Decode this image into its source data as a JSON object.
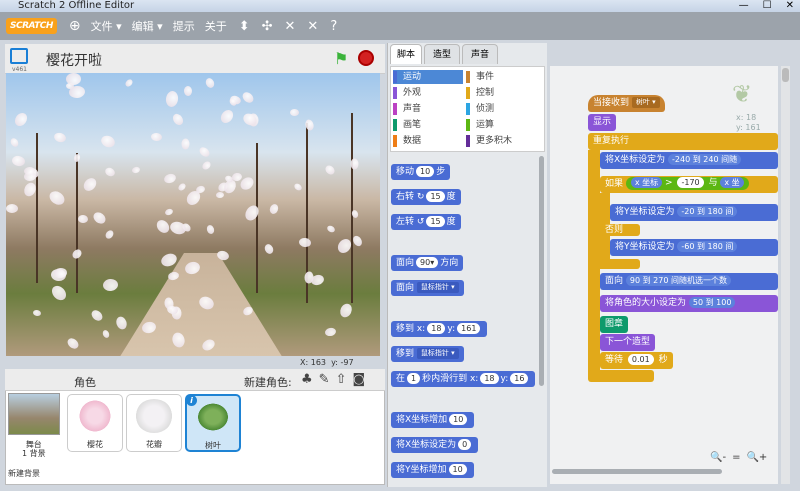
{
  "window": {
    "title": "Scratch 2 Offline Editor",
    "controls": [
      "—",
      "☐",
      "✕"
    ]
  },
  "menubar": {
    "logo": "SCRATCH",
    "menus": [
      "文件 ▾",
      "编辑 ▾",
      "提示",
      "关于"
    ],
    "tools": [
      "⬍",
      "✣",
      "✕",
      "✕",
      "?"
    ]
  },
  "stage": {
    "project_title": "樱花开啦",
    "version": "v461",
    "mouse_x_label": "X:",
    "mouse_x": "163",
    "mouse_y_label": "y:",
    "mouse_y": "-97"
  },
  "sprites": {
    "label": "角色",
    "new_sprite_label": "新建角色:",
    "stage_thumb": {
      "name": "舞台",
      "count": "1 背景"
    },
    "new_bg_label": "新建背景",
    "items": [
      {
        "name": "樱花"
      },
      {
        "name": "花瓣"
      },
      {
        "name": "树叶"
      }
    ]
  },
  "palette": {
    "tabs": [
      "脚本",
      "造型",
      "声音"
    ],
    "categories_left": [
      "运动",
      "外观",
      "声音",
      "画笔",
      "数据"
    ],
    "categories_right": [
      "事件",
      "控制",
      "侦测",
      "运算",
      "更多积木"
    ],
    "colors_left": [
      "#4a6cd4",
      "#8a55d7",
      "#bb42c3",
      "#0e9a6c",
      "#ee7d16"
    ],
    "colors_right": [
      "#c88330",
      "#e1a91a",
      "#2ca5e2",
      "#5cb712",
      "#632d99"
    ],
    "blocks": {
      "move": "移动",
      "move_val": "10",
      "move_unit": "步",
      "turn_right": "右转",
      "turn_right_val": "15",
      "turn_right_unit": "度",
      "turn_left": "左转",
      "turn_left_val": "15",
      "turn_left_unit": "度",
      "point_dir": "面向",
      "point_dir_val": "90▾",
      "point_dir_unit": "方向",
      "point_towards": "面向",
      "point_towards_val": "鼠标指针 ▾",
      "goto_xy": "移到 x:",
      "goto_x": "18",
      "goto_y_label": "y:",
      "goto_y": "161",
      "goto": "移到",
      "goto_val": "鼠标指针 ▾",
      "glide": "在",
      "glide_val": "1",
      "glide_mid": "秒内滑行到 x:",
      "glide_x": "18",
      "glide_y_label": "y:",
      "glide_y": "16",
      "change_x": "将X坐标增加",
      "change_x_val": "10",
      "set_x": "将X坐标设定为",
      "set_x_val": "0",
      "change_y": "将Y坐标增加",
      "change_y_val": "10"
    }
  },
  "script": {
    "hat": "当接收到",
    "hat_val": "树叶 ▾",
    "show": "显示",
    "forever": "重复执行",
    "set_x_rand": "将X坐标设定为",
    "rand1_a": "-240",
    "rand1_to": "到",
    "rand1_b": "240",
    "rand1_tail": "间随",
    "if": "如果",
    "xpos": "x 坐标",
    "gt": ">",
    "thr": "-170",
    "and": "与",
    "xpos2": "x 坐",
    "set_y_a": "将Y坐标设定为",
    "rand2_a": "-20",
    "rand2_b": "180",
    "rand2_tail": "间",
    "else": "否则",
    "set_y_b": "将Y坐标设定为",
    "rand3_a": "-60",
    "rand3_b": "180",
    "rand3_tail": "间",
    "point_rand": "面向",
    "rand4_a": "90",
    "rand4_b": "270",
    "rand4_tail": "间随机选一个数",
    "set_size": "将角色的大小设定为",
    "rand5_a": "50",
    "rand5_b": "100",
    "stamp": "图章",
    "next_costume": "下一个造型",
    "wait": "等待",
    "wait_val": "0.01",
    "wait_unit": "秒",
    "sprite_x_label": "x:",
    "sprite_x": "18",
    "sprite_y_label": "y:",
    "sprite_y": "161",
    "zoom": [
      "🔍-",
      "=",
      "🔍+"
    ]
  }
}
